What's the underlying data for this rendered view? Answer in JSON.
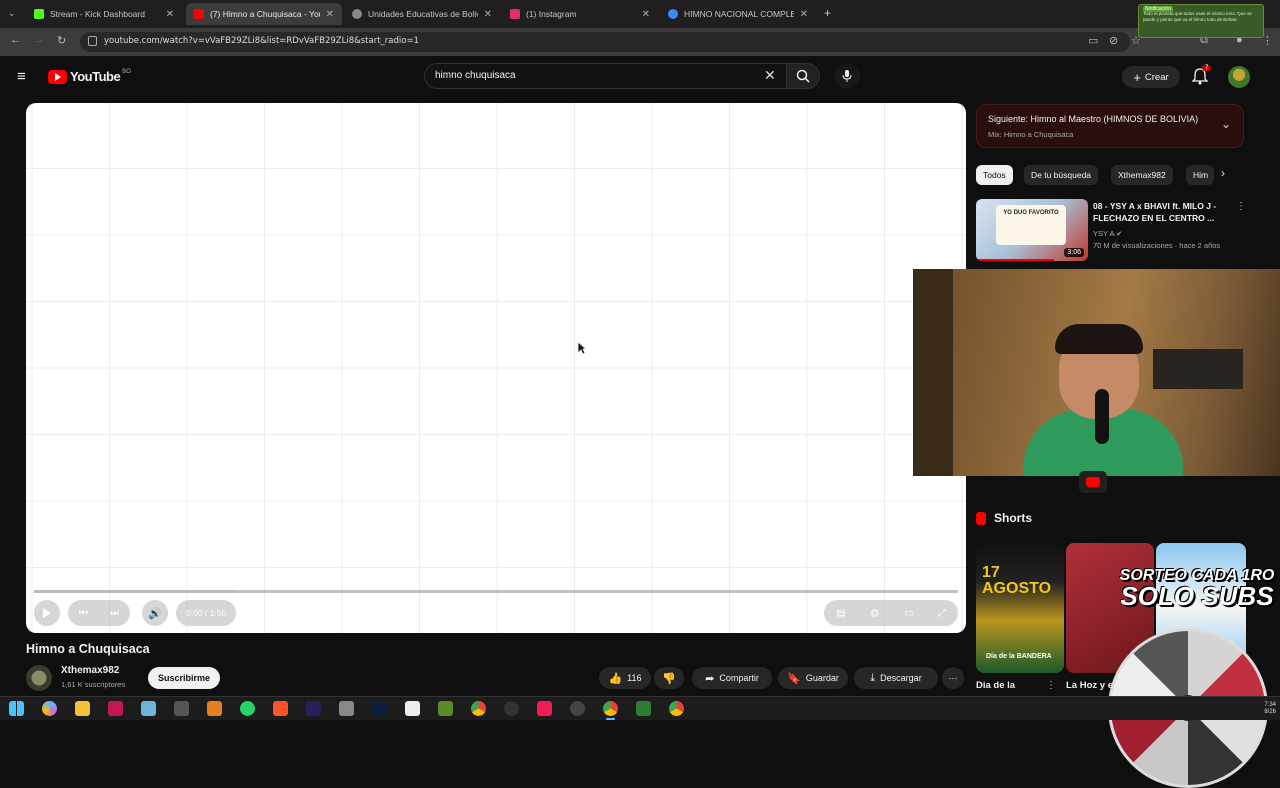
{
  "browser": {
    "tabs": [
      {
        "label": "Stream - Kick Dashboard",
        "color": "#53fc18"
      },
      {
        "label": "(7) Himno a Chuquisaca - YouTube",
        "color": "#ff0000"
      },
      {
        "label": "Unidades Educativas de Bolivia",
        "color": "#888888"
      },
      {
        "label": "(1) Instagram",
        "color": "#e1306c"
      },
      {
        "label": "HIMNO NACIONAL COMPLETO",
        "color": "#4285f4"
      }
    ],
    "url": "youtube.com/watch?v=vVaFB29ZLi8&list=RDvVaFB29ZLi8&start_radio=1"
  },
  "header": {
    "logo_text": "YouTube",
    "logo_country": "BO",
    "search_query": "himno chuquisaca",
    "create_label": "Crear",
    "notif_count": "7"
  },
  "player": {
    "time": "0:00 / 1:50",
    "buffered": 0.22
  },
  "video": {
    "title": "Himno a Chuquisaca",
    "channel": "Xthemax982",
    "subscribers": "1,61 K suscriptores",
    "subscribe_label": "Suscribirme",
    "likes": "116",
    "share_label": "Compartir",
    "save_label": "Guardar",
    "download_label": "Descargar"
  },
  "sidebar": {
    "next_title": "Siguiente: Himno al Maestro (HIMNOS DE BOLIVIA)",
    "next_sub": "Mix: Himno a Chuquisaca",
    "chips": [
      "Todos",
      "De tu búsqueda",
      "Xthemax982",
      "Him"
    ],
    "rec": {
      "title": "08 - YSY A x BHAVI ft. MILO J - FLECHAZO EN EL CENTRO ...",
      "channel": "YSY A",
      "meta": "70 M de visualizaciones · hace 2 años",
      "duration": "3:06",
      "thumb_text": "YO DUO FAVORITO"
    },
    "shorts_label": "Shorts",
    "shorts": [
      {
        "title": "Dia de la",
        "big_text": "17 AGOSTO",
        "small_text": "Día de la BANDERA"
      },
      {
        "title": "La Hoz y el"
      }
    ],
    "overlay_line1": "SORTEO CADA 1RO",
    "overlay_line2": "SOLO SUBS"
  },
  "popup": {
    "tag": "Notificación",
    "text": "Todo el planeta que todos usan el mismo tono. Que se pierde y pierde que va el himno todo de Bolivia"
  },
  "taskbar": {
    "time": "7:34",
    "date": "8/26"
  }
}
